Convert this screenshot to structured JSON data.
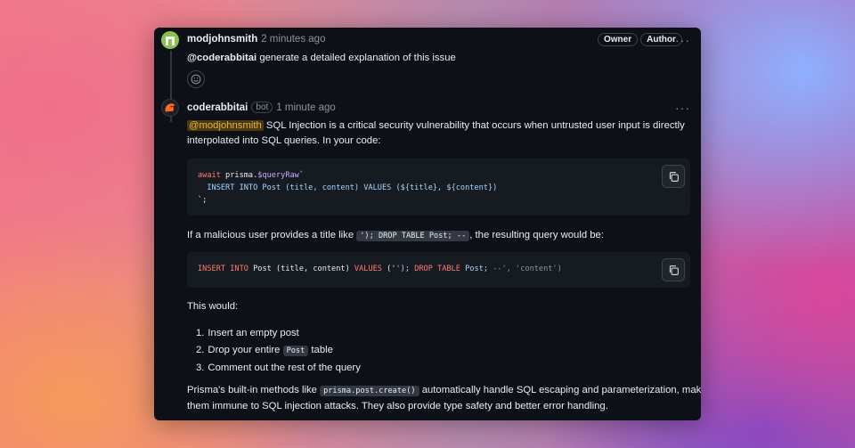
{
  "comment1": {
    "author": "modjohnsmith",
    "time": "2 minutes ago",
    "badges": [
      "Owner",
      "Author"
    ],
    "mention": "@coderabbitai",
    "text": " generate a detailed explanation of this issue",
    "reaction_icon": "smiley-icon"
  },
  "comment2": {
    "author": "coderabbitai",
    "bot_label": "bot",
    "time": "1 minute ago",
    "mention": "@modjohnsmith",
    "intro_line1": " SQL Injection is a critical security vulnerability that occurs when untrusted user input is directly",
    "intro_line2": "interpolated into SQL queries. In your code:",
    "code1": {
      "line1_kw": "await",
      "line1_rest": " prisma.",
      "line1_fn": "$queryRaw",
      "line1_tick": "`",
      "line2": "  INSERT INTO Post (title, content) VALUES (${title}, ${content})",
      "line3": "`;"
    },
    "malicious_pre": "If a malicious user provides a title like ",
    "malicious_code": "'); DROP TABLE Post; --",
    "malicious_post": ", the resulting query would be:",
    "code2": {
      "kw1": "INSERT INTO",
      "t1": " Post (title, content) ",
      "kw2": "VALUES",
      "t2": " ('",
      "t3": "'); ",
      "kw3": "DROP TABLE",
      "t4": " Post; ",
      "comment": "--', 'content')"
    },
    "this_would": "This would:",
    "list": [
      {
        "num": "1.",
        "pre": "Insert an empty post",
        "code": "",
        "post": ""
      },
      {
        "num": "2.",
        "pre": "Drop your entire ",
        "code": "Post",
        "post": " table"
      },
      {
        "num": "3.",
        "pre": "Comment out the rest of the query",
        "code": "",
        "post": ""
      }
    ],
    "outro_pre": "Prisma's built-in methods like ",
    "outro_code": "prisma.post.create()",
    "outro_post": " automatically handle SQL escaping and parameterization, making",
    "outro_line2": "them immune to SQL injection attacks. They also provide type safety and better error handling."
  },
  "icons": {
    "more": "kebab-icon",
    "copy": "copy-icon"
  },
  "colors": {
    "card_bg": "#0d1117",
    "code_bg": "#161b22",
    "mention_highlight": "#e3b341"
  }
}
